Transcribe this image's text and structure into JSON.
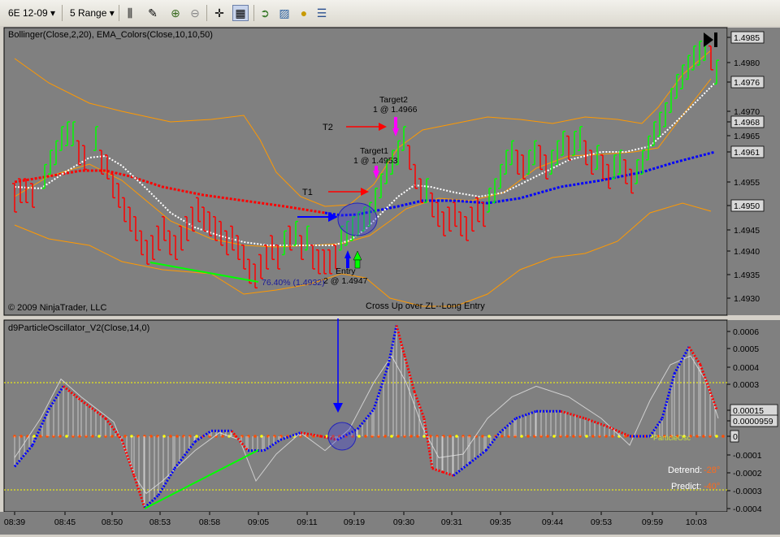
{
  "toolbar": {
    "instrument": "6E 12-09",
    "period": "5 Range",
    "icons": [
      "bar-type-icon",
      "draw-tool-icon",
      "zoom-in-icon",
      "zoom-out-icon",
      "crosshair-icon",
      "data-box-icon",
      "strategy-icon",
      "indicators-icon",
      "coin-icon",
      "properties-icon"
    ]
  },
  "price_panel": {
    "indicator_label": "Bollinger(Close,2,20), EMA_Colors(Close,10,10,50)",
    "copyright": "© 2009 NinjaTrader, LLC",
    "signal_label": "Cross Up over ZL--Long Entry",
    "y_ticks": [
      "1.4985",
      "1.4980",
      "1.4976",
      "1.4970",
      "1.4968",
      "1.4965",
      "1.4961",
      "1.4955",
      "1.4950",
      "1.4945",
      "1.4940",
      "1.4935",
      "1.4930"
    ],
    "annotations": {
      "t2": "T2",
      "t1": "T1",
      "target2_title": "Target2",
      "target2_detail": "1 @ 1.4966",
      "target1_title": "Target1",
      "target1_detail": "1 @ 1.4953",
      "entry_title": "Entry",
      "entry_detail": "2 @ 1.4947",
      "fib_label": "76.40% (1.4932)"
    }
  },
  "osc_panel": {
    "indicator_label": "d9ParticleOscillator_V2(Close,14,0)",
    "y_ticks": [
      "0.0006",
      "0.0005",
      "0.0004",
      "0.0003",
      "0.00015",
      "0.0000959",
      "0",
      "-0.0001",
      "-0.0002",
      "-0.0003",
      "-0.0004"
    ],
    "detrend_label": "Detrend:",
    "detrend_value": "-28°",
    "predict_label": "Predict:",
    "predict_value": "-40°",
    "particle_label": "ParticleOsc"
  },
  "x_axis": {
    "ticks": [
      "08:39",
      "08:45",
      "08:50",
      "08:53",
      "08:58",
      "09:05",
      "09:11",
      "09:19",
      "09:30",
      "09:31",
      "09:35",
      "09:44",
      "09:53",
      "09:59",
      "10:03"
    ]
  },
  "colors": {
    "background": "#808080",
    "up_bar": "#00ff00",
    "down_bar": "#ff0000",
    "ema_slow": "#0000ff",
    "ema_fast": "#ffffff",
    "bollinger": "#ff9900",
    "zero_line": "#ff4d00",
    "level_line": "#ffff00"
  }
}
